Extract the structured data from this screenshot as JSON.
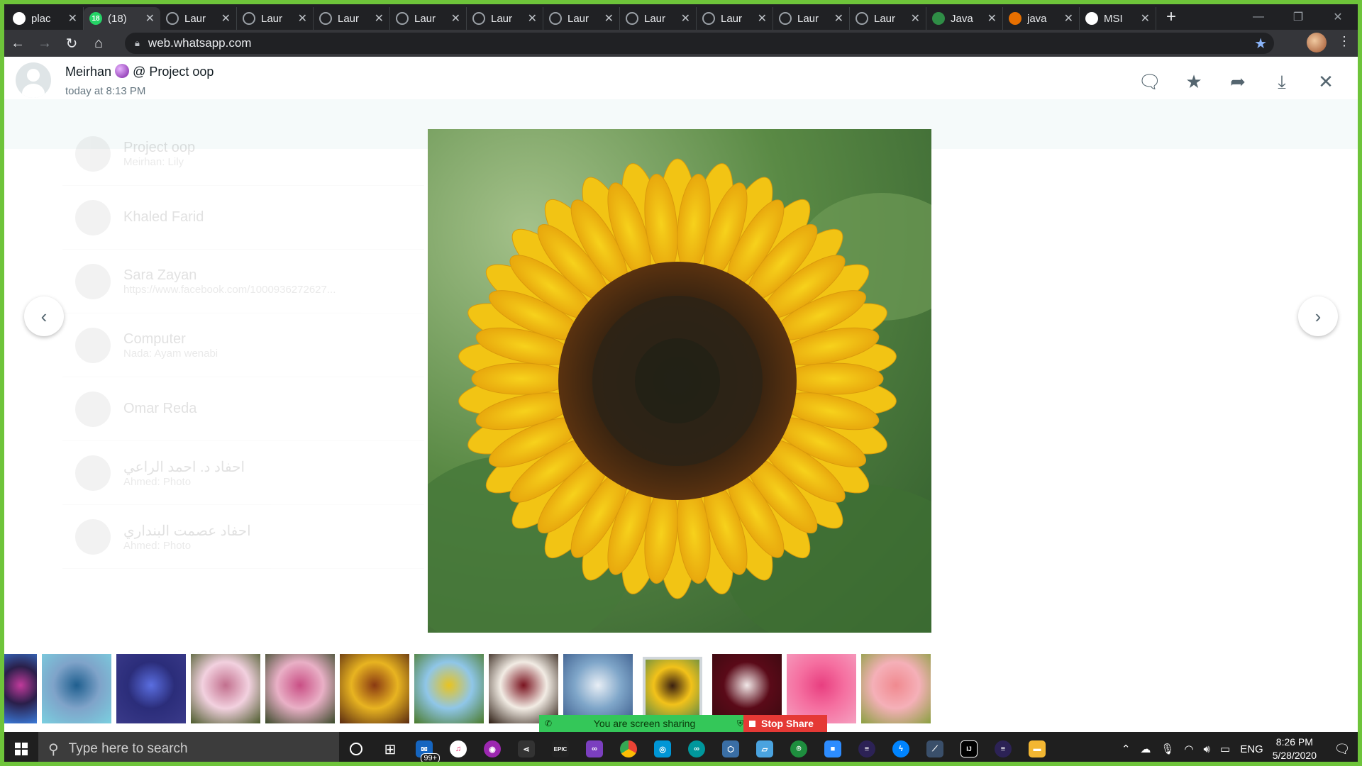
{
  "browser": {
    "tabs": [
      {
        "title": "plac",
        "icon": "google-icon",
        "color": "#ffffff"
      },
      {
        "title": "(18)",
        "icon": "whatsapp-icon",
        "color": "#25d366",
        "badge": "18"
      },
      {
        "title": "Laur",
        "icon": "globe-icon",
        "color": "#9aa0a6"
      },
      {
        "title": "Laur",
        "icon": "globe-icon",
        "color": "#9aa0a6"
      },
      {
        "title": "Laur",
        "icon": "globe-icon",
        "color": "#9aa0a6"
      },
      {
        "title": "Laur",
        "icon": "globe-icon",
        "color": "#9aa0a6"
      },
      {
        "title": "Laur",
        "icon": "globe-icon",
        "color": "#9aa0a6"
      },
      {
        "title": "Laur",
        "icon": "globe-icon",
        "color": "#9aa0a6"
      },
      {
        "title": "Laur",
        "icon": "globe-icon",
        "color": "#9aa0a6"
      },
      {
        "title": "Laur",
        "icon": "globe-icon",
        "color": "#9aa0a6"
      },
      {
        "title": "Laur",
        "icon": "globe-icon",
        "color": "#9aa0a6"
      },
      {
        "title": "Laur",
        "icon": "globe-icon",
        "color": "#9aa0a6"
      },
      {
        "title": "Java",
        "icon": "geeks-icon",
        "color": "#2f8d46"
      },
      {
        "title": "java",
        "icon": "java-icon",
        "color": "#e76f00"
      },
      {
        "title": "MSI",
        "icon": "msi-icon",
        "color": "#ffffff"
      }
    ],
    "url": "web.whatsapp.com"
  },
  "viewer": {
    "sender": "Meirhan",
    "group": "@ Project oop",
    "timestamp": "today at 8:13 PM",
    "actions": [
      "chat-icon",
      "star-icon",
      "forward-icon",
      "download-icon",
      "close-icon"
    ]
  },
  "background_chats": [
    {
      "name": "Project oop",
      "preview": "Meirhan: Lily"
    },
    {
      "name": "Khaled Farid",
      "preview": ""
    },
    {
      "name": "Sara Zayan",
      "preview": "https://www.facebook.com/1000936272627..."
    },
    {
      "name": "Computer",
      "preview": "Nada: Ayam wenabi"
    },
    {
      "name": "Omar Reda",
      "preview": ""
    },
    {
      "name": "احفاد د. احمد الراعي",
      "preview": "Ahmed: Photo"
    },
    {
      "name": "احفاد عصمت البنداري",
      "preview": "Ahmed: Photo"
    }
  ],
  "thumbnails": [
    {
      "name": "abstract-lights",
      "colors": [
        "#2a1f4a",
        "#c03a9b",
        "#3a7ad9"
      ]
    },
    {
      "name": "ocean",
      "colors": [
        "#7fa3c9",
        "#1f5f8f",
        "#7ad0e0"
      ]
    },
    {
      "name": "blue-lily",
      "colors": [
        "#2b2d7a",
        "#5a6ee0",
        "#3a3a8a"
      ]
    },
    {
      "name": "pink-lilies",
      "colors": [
        "#f2d1df",
        "#c2708e",
        "#4a5a2a"
      ]
    },
    {
      "name": "pink-lily",
      "colors": [
        "#e9b0c6",
        "#c94f85",
        "#3a4a2a"
      ]
    },
    {
      "name": "sunflowers-bunch",
      "colors": [
        "#e8b421",
        "#8a3a12",
        "#5a2a10"
      ]
    },
    {
      "name": "sunflowers-sky",
      "colors": [
        "#8fc6e8",
        "#e8c421",
        "#4a7a2a"
      ]
    },
    {
      "name": "roses-red-white",
      "colors": [
        "#f2ece4",
        "#7a1420",
        "#2a1a10"
      ]
    },
    {
      "name": "blue-flower",
      "colors": [
        "#7fa6c9",
        "#e8eef5",
        "#3a5a8a"
      ]
    },
    {
      "name": "sunflower",
      "colors": [
        "#f2c21a",
        "#3a2010",
        "#5f8a45"
      ]
    },
    {
      "name": "rose-dark",
      "colors": [
        "#5a0a18",
        "#f2e8e8",
        "#3a0a10"
      ]
    },
    {
      "name": "pink-tulip",
      "colors": [
        "#f56fa0",
        "#e83f80",
        "#f5a0c0"
      ]
    },
    {
      "name": "tulips",
      "colors": [
        "#f5b0b8",
        "#f08a90",
        "#8aa040"
      ]
    }
  ],
  "share": {
    "message": "You are screen sharing",
    "stop_label": "Stop Share"
  },
  "taskbar": {
    "search_placeholder": "Type here to search",
    "mail_badge": "99+",
    "language": "ENG",
    "time": "8:26 PM",
    "date": "5/28/2020"
  }
}
